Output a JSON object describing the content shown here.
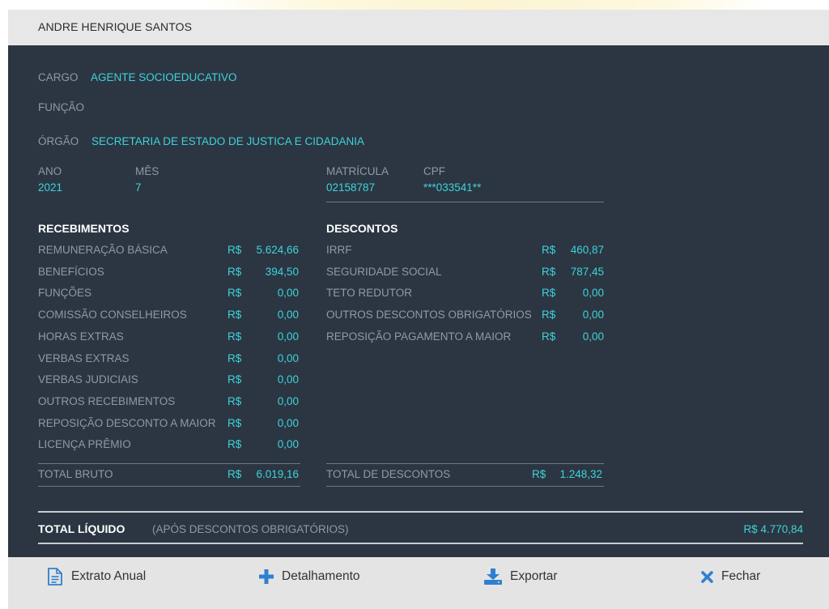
{
  "header": {
    "name": "ANDRE HENRIQUE SANTOS"
  },
  "info": {
    "cargo_label": "CARGO",
    "cargo_value": "AGENTE SOCIOEDUCATIVO",
    "funcao_label": "FUNÇÃO",
    "orgao_label": "ÓRGÃO",
    "orgao_value": "SECRETARIA DE ESTADO DE JUSTICA E CIDADANIA",
    "ano_label": "ANO",
    "ano_value": "2021",
    "mes_label": "MÊS",
    "mes_value": "7",
    "matricula_label": "MATRÍCULA",
    "matricula_value": "02158787",
    "cpf_label": "CPF",
    "cpf_value": "***033541**"
  },
  "recebimentos": {
    "title": "RECEBIMENTOS",
    "rows": [
      {
        "label": "REMUNERAÇÃO BÁSICA",
        "currency": "R$",
        "amount": "5.624,66"
      },
      {
        "label": "BENEFÍCIOS",
        "currency": "R$",
        "amount": "394,50"
      },
      {
        "label": "FUNÇÕES",
        "currency": "R$",
        "amount": "0,00"
      },
      {
        "label": "COMISSÃO CONSELHEIROS",
        "currency": "R$",
        "amount": "0,00"
      },
      {
        "label": "HORAS EXTRAS",
        "currency": "R$",
        "amount": "0,00"
      },
      {
        "label": "VERBAS EXTRAS",
        "currency": "R$",
        "amount": "0,00"
      },
      {
        "label": "VERBAS JUDICIAIS",
        "currency": "R$",
        "amount": "0,00"
      },
      {
        "label": "OUTROS RECEBIMENTOS",
        "currency": "R$",
        "amount": "0,00"
      },
      {
        "label": "REPOSIÇÃO DESCONTO A MAIOR",
        "currency": "R$",
        "amount": "0,00"
      },
      {
        "label": "LICENÇA PRÊMIO",
        "currency": "R$",
        "amount": "0,00"
      }
    ],
    "total_label": "TOTAL BRUTO",
    "total_currency": "R$",
    "total_amount": "6.019,16"
  },
  "descontos": {
    "title": "DESCONTOS",
    "rows": [
      {
        "label": "IRRF",
        "currency": "R$",
        "amount": "460,87"
      },
      {
        "label": "SEGURIDADE SOCIAL",
        "currency": "R$",
        "amount": "787,45"
      },
      {
        "label": "TETO REDUTOR",
        "currency": "R$",
        "amount": "0,00"
      },
      {
        "label": "OUTROS DESCONTOS OBRIGATÓRIOS",
        "currency": "R$",
        "amount": "0,00"
      },
      {
        "label": "REPOSIÇÃO PAGAMENTO A MAIOR",
        "currency": "R$",
        "amount": "0,00"
      }
    ],
    "total_label": "TOTAL DE DESCONTOS",
    "total_currency": "R$",
    "total_amount": "1.248,32"
  },
  "liquido": {
    "label": "TOTAL LÍQUIDO",
    "note": "(APÓS DESCONTOS OBRIGATÓRIOS)",
    "value": "R$ 4.770,84"
  },
  "footer": {
    "extrato_label": "Extrato Anual",
    "detalhamento_label": "Detalhamento",
    "exportar_label": "Exportar",
    "fechar_label": "Fechar"
  },
  "colors": {
    "panel_bg": "#2b3642",
    "accent": "#3fd2da",
    "muted_text": "#8f9aa6",
    "header_bg": "#e7e7e7",
    "footer_bg": "#e4e4e4",
    "icon_blue": "#2f7fd1"
  }
}
